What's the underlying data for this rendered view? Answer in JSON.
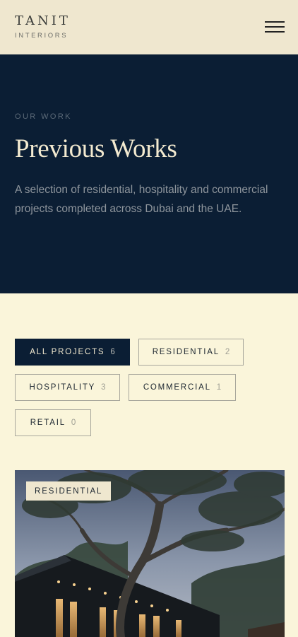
{
  "header": {
    "brand_name": "TANIT",
    "brand_sub": "INTERIORS",
    "menu_icon": "hamburger-menu-icon"
  },
  "hero": {
    "eyebrow": "OUR WORK",
    "title": "Previous Works",
    "description": "A selection of residential, hospitality and commercial projects completed across Dubai and the UAE."
  },
  "filters": [
    {
      "label": "ALL PROJECTS",
      "count": "6",
      "active": true
    },
    {
      "label": "RESIDENTIAL",
      "count": "2",
      "active": false
    },
    {
      "label": "HOSPITALITY",
      "count": "3",
      "active": false
    },
    {
      "label": "COMMERCIAL",
      "count": "1",
      "active": false
    },
    {
      "label": "RETAIL",
      "count": "0",
      "active": false
    }
  ],
  "projects": [
    {
      "tag": "RESIDENTIAL"
    }
  ],
  "colors": {
    "navy": "#0b1e34",
    "cream": "#faf5da",
    "header_bg": "#efe7cf",
    "title_cream": "#f3ead0"
  }
}
